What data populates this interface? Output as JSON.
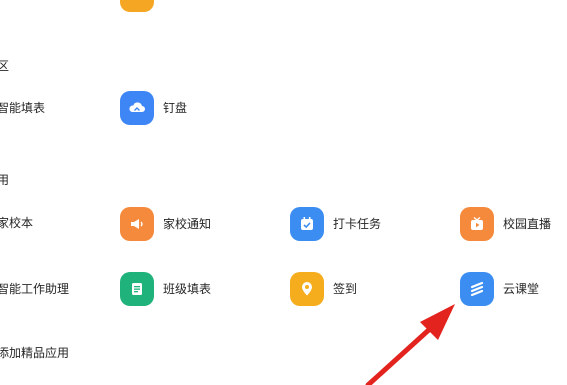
{
  "top_partial_icon": {
    "color": "#f5a623",
    "icon": "partial-app-icon"
  },
  "sections": {
    "section1_tail": "区",
    "section2_tail": "用"
  },
  "row1": {
    "left_cut": "智能填表",
    "app": {
      "label": "钉盘",
      "icon": "cloud-drive-icon",
      "color": "#3e86f5"
    }
  },
  "row2": {
    "left_cut": "家校本",
    "apps": [
      {
        "label": "家校通知",
        "icon": "megaphone-icon",
        "color": "#f58a3d"
      },
      {
        "label": "打卡任务",
        "icon": "calendar-check-icon",
        "color": "#3b8df2"
      },
      {
        "label": "校园直播",
        "icon": "live-play-icon",
        "color": "#f58a3d"
      }
    ]
  },
  "row3": {
    "left_cut": "智能工作助理",
    "apps": [
      {
        "label": "班级填表",
        "icon": "form-doc-icon",
        "color": "#1fb27a"
      },
      {
        "label": "签到",
        "icon": "location-pin-icon",
        "color": "#f5ad1e"
      },
      {
        "label": "云课堂",
        "icon": "cloud-class-icon",
        "color": "#3b8df2"
      }
    ]
  },
  "row4": {
    "left_cut": "添加精品应用"
  },
  "annotation": {
    "arrow_color": "#e3231e"
  }
}
